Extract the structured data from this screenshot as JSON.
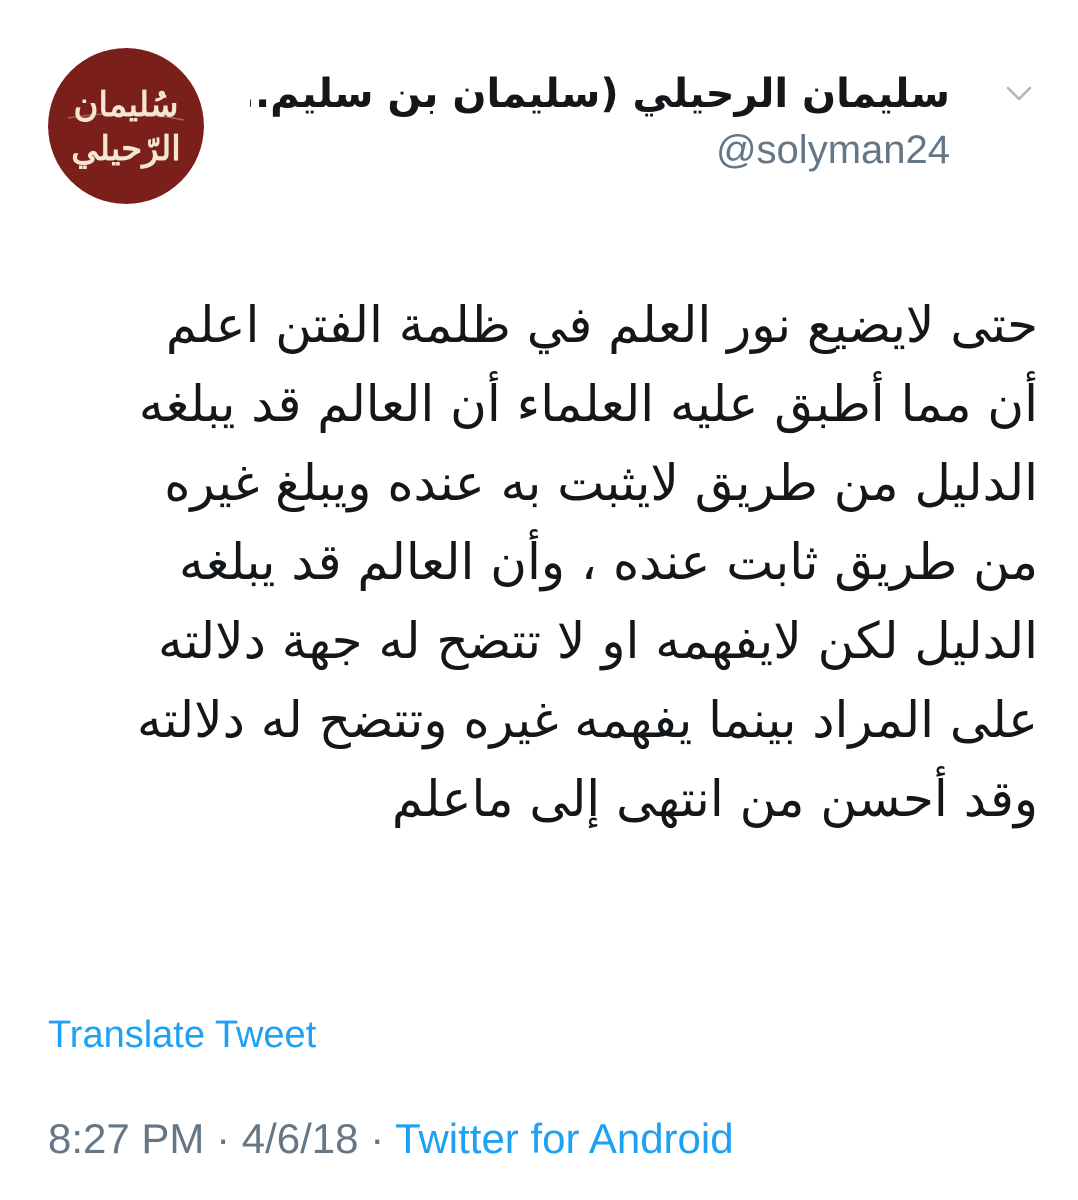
{
  "tweet": {
    "author": {
      "display_name": "سليمان الرحيلي (سليمان بن سليم...",
      "handle": "@solyman24",
      "avatar_text_line1": "سُليمان",
      "avatar_text_line2": "الرّحيلي",
      "avatar_bg": "#7a1f1a",
      "avatar_text_color": "#f4e6d2"
    },
    "menu_icon": "chevron-down-icon",
    "text_lines": [
      "حتى لايضيع نور العلم في ظلمة الفتن اعلم",
      "أن مما أطبق عليه العلماء أن العالم قد يبلغه",
      "الدليل من طريق لايثبت به عنده ويبلغ غيره",
      "من طريق ثابت عنده ، وأن العالم قد يبلغه",
      "الدليل لكن لايفهمه او لا تتضح له جهة دلالته",
      "على المراد بينما يفهمه غيره وتتضح له دلالته",
      "وقد أحسن من انتهى إلى ماعلم"
    ],
    "translate_label": "Translate Tweet",
    "time": "8:27 PM",
    "separator1": " · ",
    "date": "4/6/18",
    "separator2": " · ",
    "source": "Twitter for Android",
    "colors": {
      "link": "#1da1f2",
      "muted": "#657786",
      "text": "#14171a"
    }
  }
}
